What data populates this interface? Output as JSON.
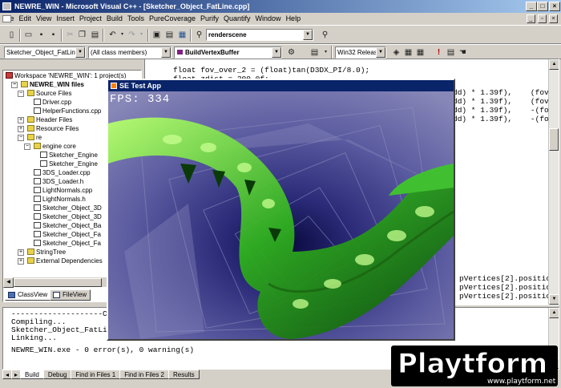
{
  "window": {
    "title": "NEWRE_WIN - Microsoft Visual C++ - [Sketcher_Object_FatLine.cpp]"
  },
  "menu": [
    "File",
    "Edit",
    "View",
    "Insert",
    "Project",
    "Build",
    "Tools",
    "PureCoverage",
    "Purify",
    "Quantify",
    "Window",
    "Help"
  ],
  "toolbar1": {
    "find_combo": "renderscene"
  },
  "toolbar2": {
    "class_combo": "Sketcher_Object_FatLine",
    "members_combo": "(All class members)",
    "function_combo": "BuildVertexBuffer",
    "config_combo": "Win32 Release"
  },
  "workspace": {
    "root": "Workspace 'NEWRE_WIN': 1 project(s)",
    "project": "NEWRE_WIN files",
    "items": [
      {
        "label": "Source Files",
        "type": "folder",
        "level": 2
      },
      {
        "label": "Driver.cpp",
        "type": "file",
        "level": 3
      },
      {
        "label": "HelperFunctions.cpp",
        "type": "file",
        "level": 3
      },
      {
        "label": "Header Files",
        "type": "folder",
        "level": 2
      },
      {
        "label": "Resource Files",
        "type": "folder",
        "level": 2
      },
      {
        "label": "re",
        "type": "folder",
        "level": 2
      },
      {
        "label": "engine core",
        "type": "folder",
        "level": 3
      },
      {
        "label": "Sketcher_Engine",
        "type": "file",
        "level": 4
      },
      {
        "label": "Sketcher_Engine",
        "type": "file",
        "level": 4
      },
      {
        "label": "3DS_Loader.cpp",
        "type": "file",
        "level": 3
      },
      {
        "label": "3DS_Loader.h",
        "type": "file",
        "level": 3
      },
      {
        "label": "LightNormals.cpp",
        "type": "file",
        "level": 3
      },
      {
        "label": "LightNormals.h",
        "type": "file",
        "level": 3
      },
      {
        "label": "Sketcher_Object_3D",
        "type": "file",
        "level": 3
      },
      {
        "label": "Sketcher_Object_3D",
        "type": "file",
        "level": 3
      },
      {
        "label": "Sketcher_Object_Ba",
        "type": "file",
        "level": 3
      },
      {
        "label": "Sketcher_Object_Fa",
        "type": "file",
        "level": 3
      },
      {
        "label": "Sketcher_Object_Fa",
        "type": "file",
        "level": 3
      },
      {
        "label": "StringTree",
        "type": "folder",
        "level": 2
      },
      {
        "label": "External Dependencies",
        "type": "folder",
        "level": 2
      }
    ],
    "tabs": [
      "ClassView",
      "FileView"
    ]
  },
  "editor": {
    "line1": "float fov_over_2 = (float)tan(D3DX_PI/8.0);",
    "line2": "float zdist = 200.0f;",
    "right_lines": [
      "dd) * 1.39f),    (fov_o",
      "dd) * 1.39f),    (fov_o",
      "dd) * 1.39f),    -(fov_",
      "dd) * 1.39f),    -(fov_"
    ],
    "bottom_lines": [
      "pVertices[2].position",
      "pVertices[2].position",
      "pVertices[2].position"
    ]
  },
  "output": {
    "lines": [
      "--------------------Co",
      "Compiling...",
      "Sketcher_Object_FatLi",
      "Linking...",
      "",
      "NEWRE_WIN.exe - 0 error(s), 0 warning(s)"
    ],
    "tabs": [
      "Build",
      "Debug",
      "Find in Files 1",
      "Find in Files 2",
      "Results"
    ]
  },
  "test_app": {
    "title": "SE Test App",
    "fps": "FPS: 334"
  },
  "watermark": {
    "brand": "Playtform",
    "url": "www.playtform.net"
  }
}
